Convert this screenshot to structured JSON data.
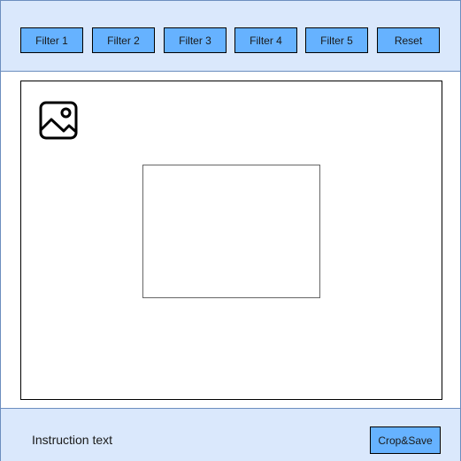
{
  "toolbar": {
    "filters": [
      {
        "label": "Filter 1"
      },
      {
        "label": "Filter 2"
      },
      {
        "label": "Filter 3"
      },
      {
        "label": "Filter 4"
      },
      {
        "label": "Filter 5"
      }
    ],
    "reset_label": "Reset"
  },
  "canvas": {
    "image_icon": "image-icon"
  },
  "footer": {
    "instruction_text": "Instruction text",
    "crop_save_label": "Crop&Save"
  },
  "colors": {
    "panel_background": "#dae8fc",
    "panel_border": "#6c8ebf",
    "button_fill": "#66b2ff"
  }
}
